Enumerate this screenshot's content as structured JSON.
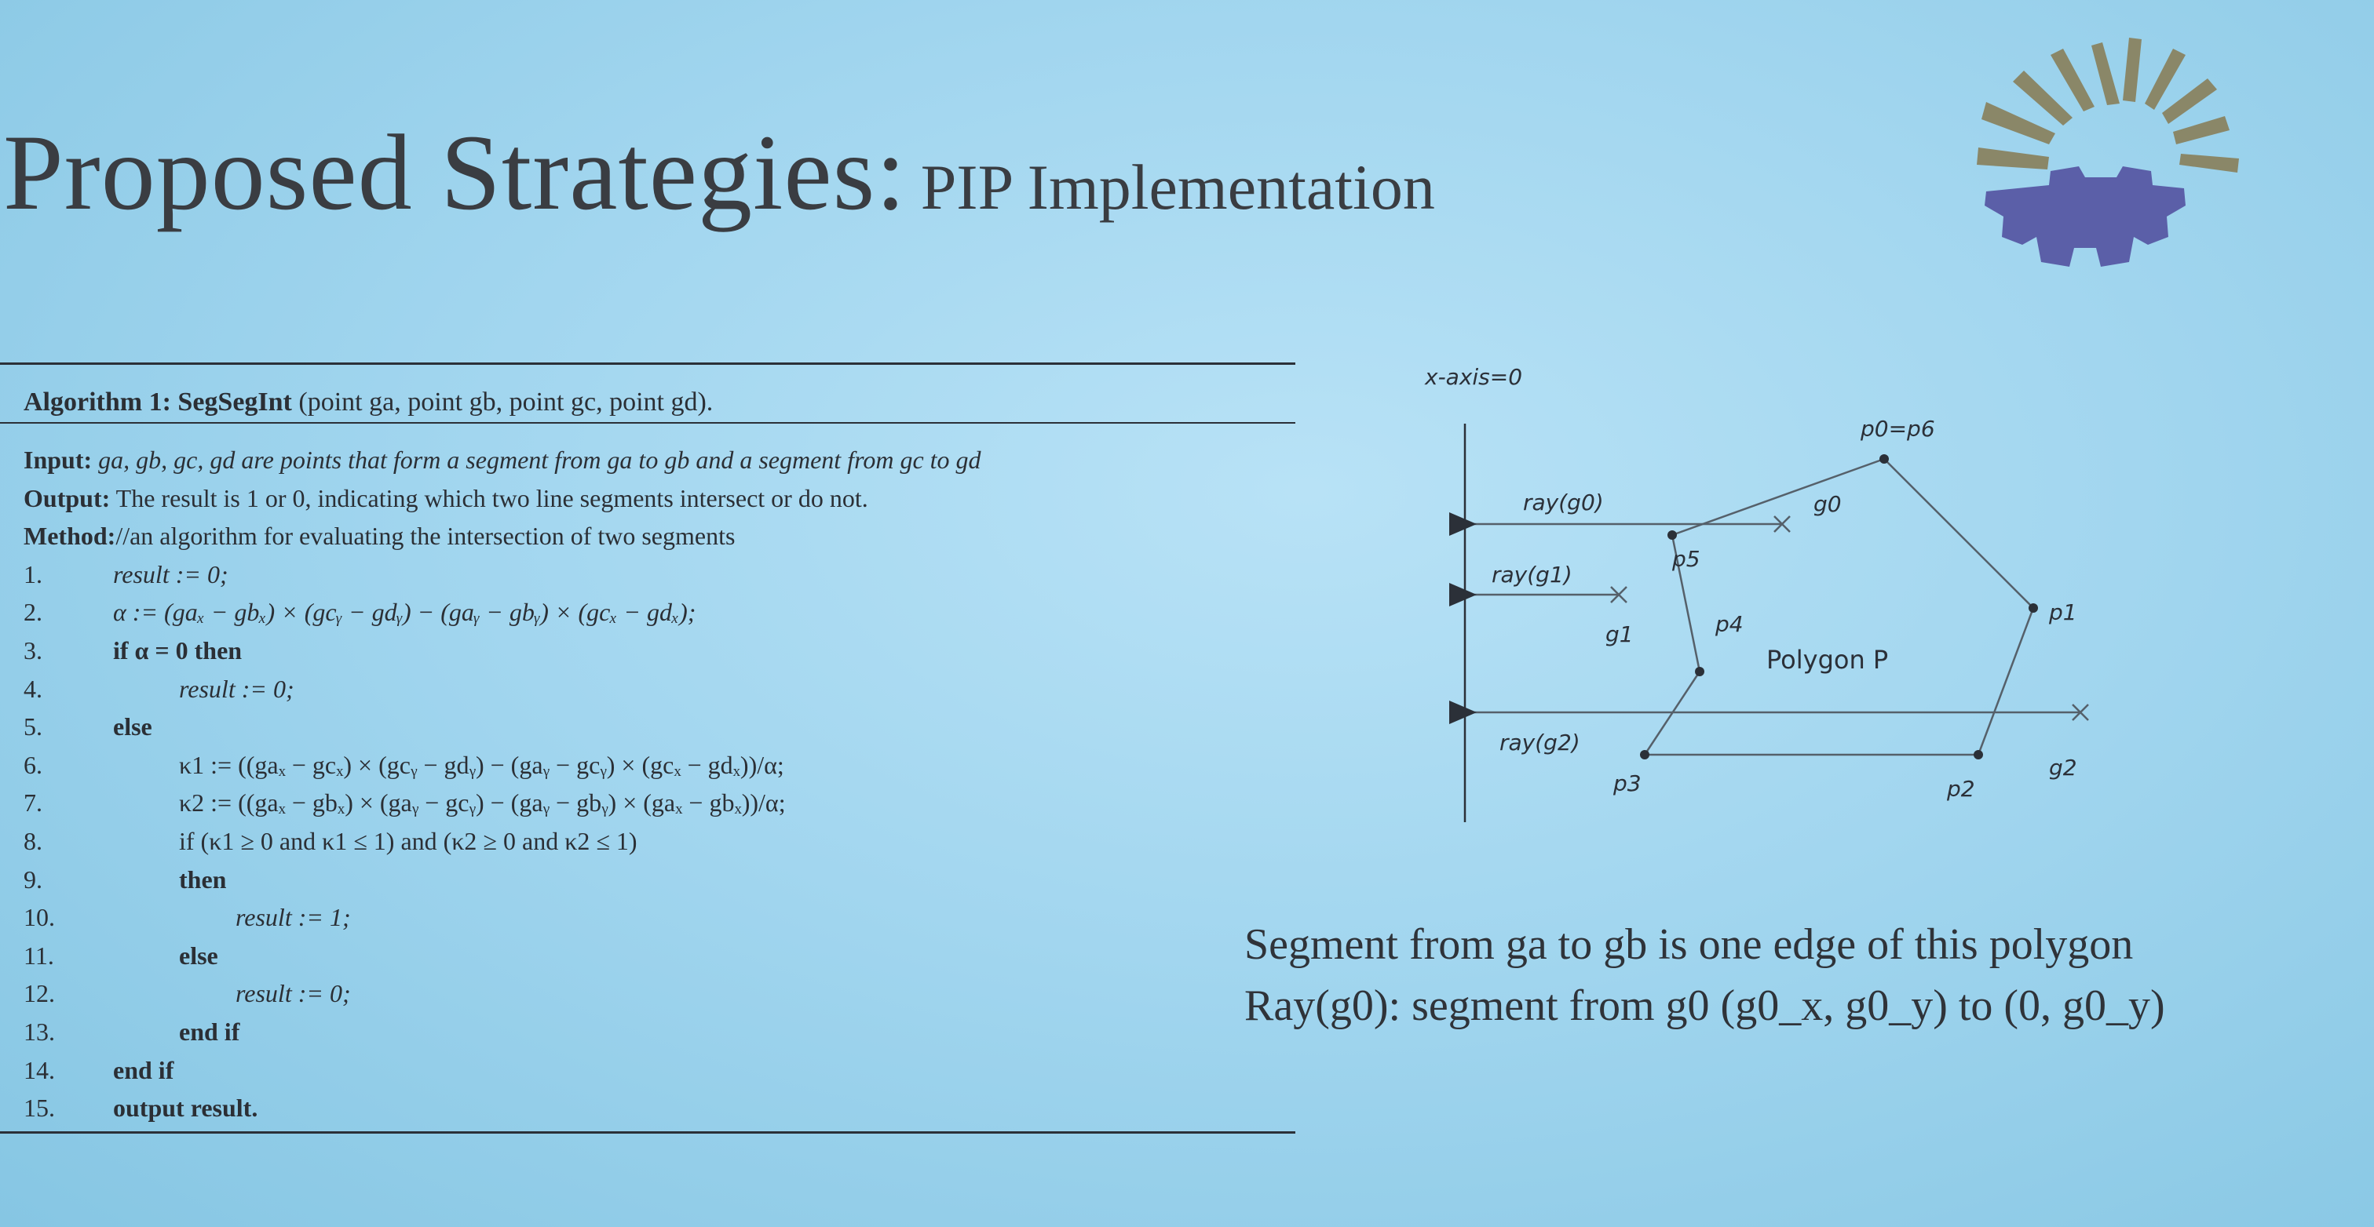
{
  "slide": {
    "title_main": "Proposed Strategies:",
    "title_sub": "PIP Implementation"
  },
  "algorithm": {
    "header_prefix": "Algorithm 1: SegSegInt",
    "header_params": "(point ga, point gb, point gc, point gd).",
    "input_label": "Input:",
    "input_text": "ga, gb, gc, gd are points that form a segment from ga to gb and a segment from gc to gd",
    "output_label": "Output:",
    "output_text": "The result is 1 or 0, indicating which two line segments intersect or do not.",
    "method_label": "Method:",
    "method_text": "//an algorithm for evaluating the intersection of two segments",
    "lines": [
      {
        "num": "1.",
        "text": "result := 0;"
      },
      {
        "num": "2.",
        "text": "α := (gaₓ − gbₓ) × (gcᵧ − gdᵧ) − (gaᵧ − gbᵧ) × (gcₓ − gdₓ);"
      },
      {
        "num": "3.",
        "text": "if α = 0 then"
      },
      {
        "num": "4.",
        "text": "result := 0;"
      },
      {
        "num": "5.",
        "text": "else"
      },
      {
        "num": "6.",
        "text": "κ1 := ((gaₓ − gcₓ) × (gcᵧ − gdᵧ) − (gaᵧ − gcᵧ) × (gcₓ − gdₓ))/α;"
      },
      {
        "num": "7.",
        "text": "κ2 := ((gaₓ − gbₓ) × (gaᵧ − gcᵧ) − (gaᵧ − gbᵧ) × (gaₓ − gbₓ))/α;"
      },
      {
        "num": "8.",
        "text": "if (κ1 ≥ 0 and κ1 ≤ 1) and (κ2 ≥ 0 and κ2 ≤ 1)"
      },
      {
        "num": "9.",
        "text": "then"
      },
      {
        "num": "10.",
        "text": "result := 1;"
      },
      {
        "num": "11.",
        "text": "else"
      },
      {
        "num": "12.",
        "text": "result := 0;"
      },
      {
        "num": "13.",
        "text": "end if"
      },
      {
        "num": "14.",
        "text": "end if"
      },
      {
        "num": "15.",
        "text": "output result."
      }
    ]
  },
  "diagram": {
    "axis_label": "x-axis=0",
    "polygon_label": "Polygon P",
    "vertex_labels": {
      "p0_p6": "p0=p6",
      "p1": "p1",
      "p2": "p2",
      "p3": "p3",
      "p4": "p4",
      "p5": "p5"
    },
    "point_labels": {
      "g0": "g0",
      "g1": "g1",
      "g2": "g2"
    },
    "ray_labels": {
      "r0": "ray(g0)",
      "r1": "ray(g1)",
      "r2": "ray(g2)"
    }
  },
  "caption": {
    "line1": "Segment from ga to gb is one edge of this polygon",
    "line2": "Ray(g0): segment from g0 (g0_x, g0_y) to (0, g0_y)"
  },
  "logo": {
    "icon": "sunburst-gear-logo",
    "color_rays": "#8a8768",
    "color_gear": "#5b5fa8"
  }
}
